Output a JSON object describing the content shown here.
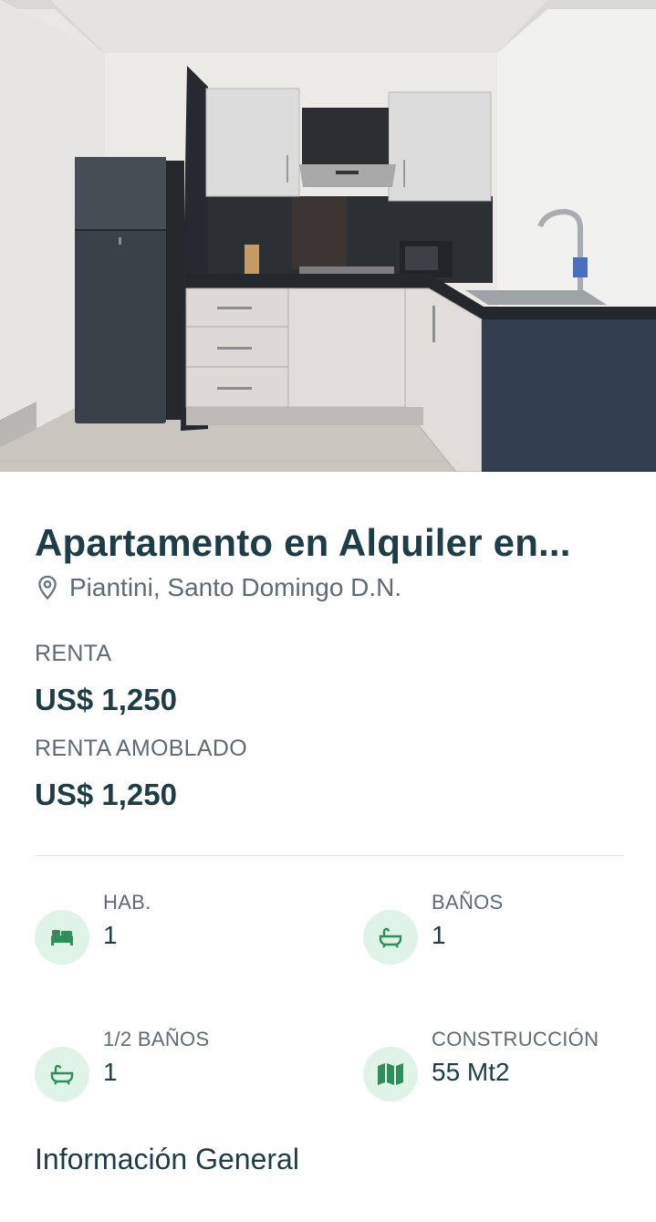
{
  "listing": {
    "title": "Apartamento en Alquiler en...",
    "location": "Piantini, Santo Domingo D.N.",
    "location_icon": "map-pin-icon"
  },
  "prices": [
    {
      "label": "RENTA",
      "value": "US$ 1,250"
    },
    {
      "label": "RENTA AMOBLADO",
      "value": "US$ 1,250"
    }
  ],
  "features": [
    {
      "label": "HAB.",
      "value": "1",
      "icon": "bed-icon"
    },
    {
      "label": "BAÑOS",
      "value": "1",
      "icon": "bathtub-icon"
    },
    {
      "label": "1/2 BAÑOS",
      "value": "1",
      "icon": "bathtub-icon"
    },
    {
      "label": "CONSTRUCCIÓN",
      "value": "55 Mt2",
      "icon": "map-icon"
    }
  ],
  "sections": {
    "general_info": "Información General"
  },
  "colors": {
    "primary_text": "#1f3d47",
    "muted_text": "#5e6b75",
    "icon_bg": "#dff3e6",
    "icon_fg": "#2f8f5b"
  }
}
